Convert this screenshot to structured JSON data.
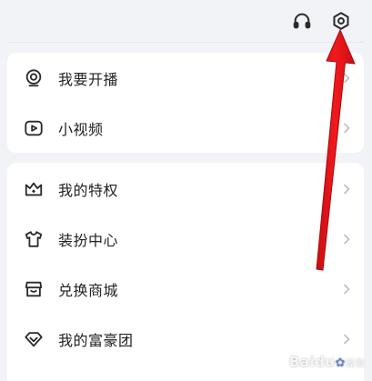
{
  "header": {
    "headphone_icon": "headphone-icon",
    "settings_icon": "settings-gear-icon"
  },
  "menu_group_1": [
    {
      "label": "我要开播",
      "icon": "live-camera-icon"
    },
    {
      "label": "小视频",
      "icon": "video-play-icon"
    }
  ],
  "menu_group_2": [
    {
      "label": "我的特权",
      "icon": "crown-icon"
    },
    {
      "label": "装扮中心",
      "icon": "shirt-icon"
    },
    {
      "label": "兑换商城",
      "icon": "store-icon"
    },
    {
      "label": "我的富豪团",
      "icon": "diamond-icon"
    }
  ],
  "annotation": {
    "arrow_color": "#e8151a"
  },
  "watermark": {
    "brand": "Baidu",
    "suffix": "经验"
  },
  "colors": {
    "background": "#f2f3f7",
    "card": "#ffffff",
    "text": "#222222",
    "icon": "#2b2b2b",
    "chevron": "#b9bcc4"
  }
}
